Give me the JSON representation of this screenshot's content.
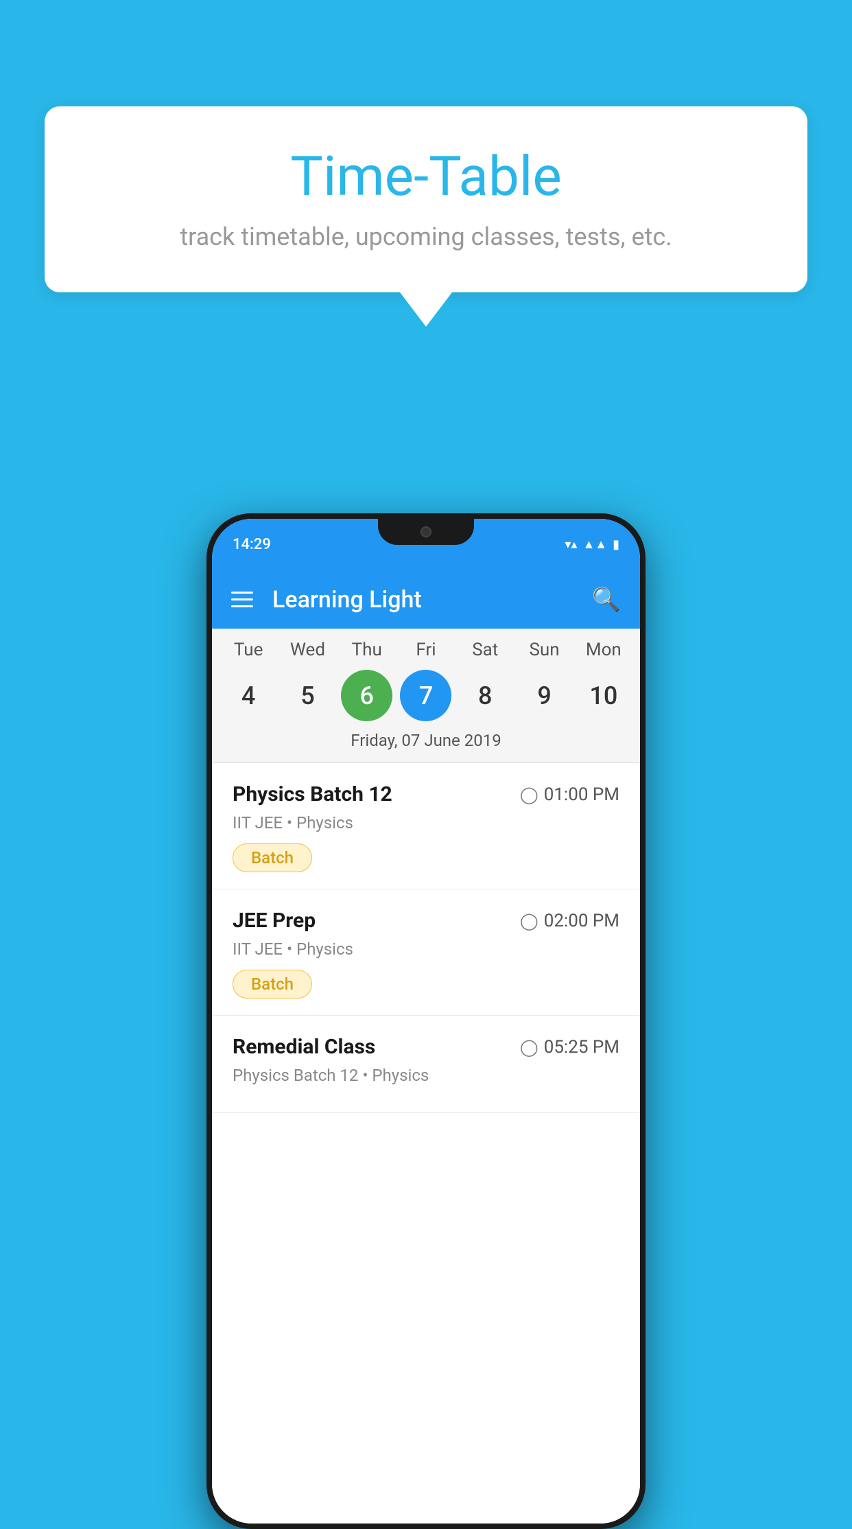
{
  "background_color": "#29b6e8",
  "bubble": {
    "title": "Time-Table",
    "subtitle": "track timetable, upcoming classes, tests, etc."
  },
  "app": {
    "status_time": "14:29",
    "title": "Learning Light"
  },
  "calendar": {
    "days": [
      {
        "name": "Tue",
        "num": "4",
        "state": "normal"
      },
      {
        "name": "Wed",
        "num": "5",
        "state": "normal"
      },
      {
        "name": "Thu",
        "num": "6",
        "state": "today"
      },
      {
        "name": "Fri",
        "num": "7",
        "state": "selected"
      },
      {
        "name": "Sat",
        "num": "8",
        "state": "normal"
      },
      {
        "name": "Sun",
        "num": "9",
        "state": "normal"
      },
      {
        "name": "Mon",
        "num": "10",
        "state": "normal"
      }
    ],
    "selected_date": "Friday, 07 June 2019"
  },
  "schedule": {
    "items": [
      {
        "name": "Physics Batch 12",
        "time": "01:00 PM",
        "detail": "IIT JEE • Physics",
        "badge": "Batch"
      },
      {
        "name": "JEE Prep",
        "time": "02:00 PM",
        "detail": "IIT JEE • Physics",
        "badge": "Batch"
      },
      {
        "name": "Remedial Class",
        "time": "05:25 PM",
        "detail": "Physics Batch 12 • Physics",
        "badge": null
      }
    ]
  },
  "labels": {
    "batch": "Batch"
  }
}
